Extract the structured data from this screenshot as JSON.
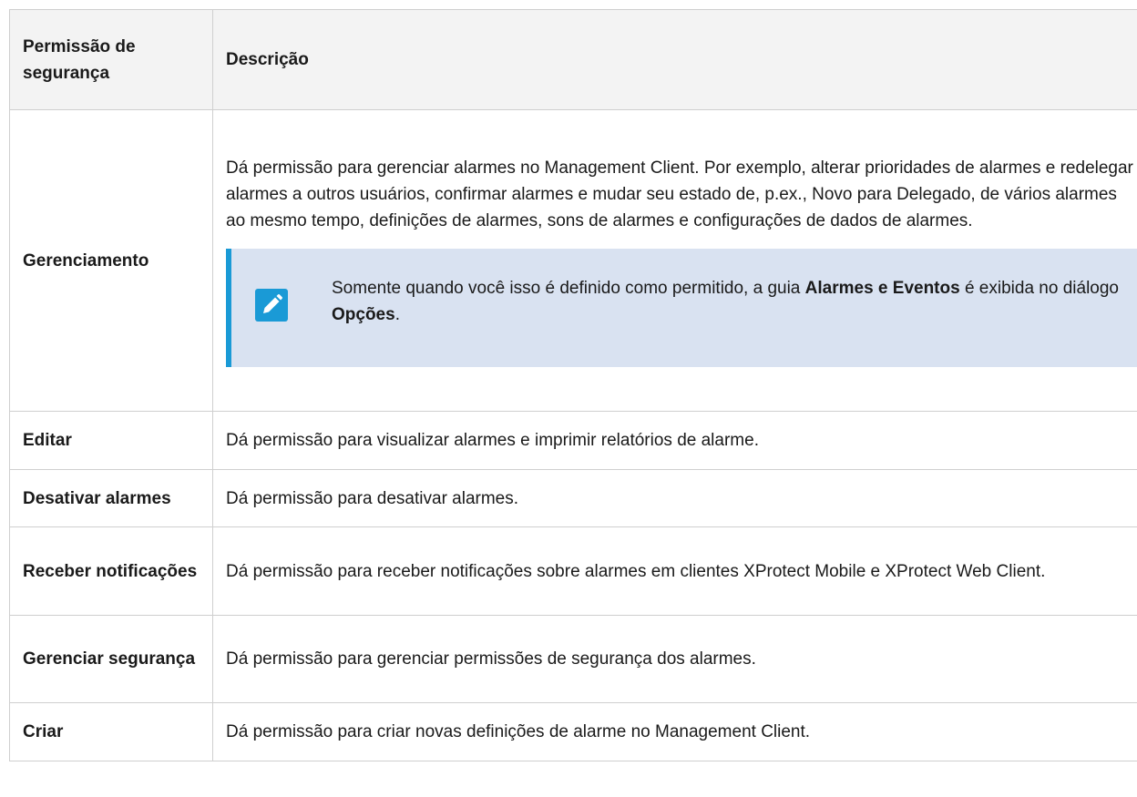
{
  "table": {
    "header": {
      "col1": "Permissão de segurança",
      "col2": "Descrição"
    },
    "rows": [
      {
        "permission": "Gerenciamento",
        "description": "Dá permissão para gerenciar alarmes no Management Client. Por exemplo, alterar prioridades de alarmes e redelegar alarmes a outros usuários, confirmar alarmes e mudar seu estado de, p.ex., Novo para Delegado, de vários alarmes ao mesmo tempo, definições de alarmes, sons de alarmes e configurações de dados de alarmes.",
        "note": {
          "icon": "pencil-icon",
          "text_before": "Somente quando você isso é definido como permitido, a guia ",
          "bold1": "Alarmes e Eventos",
          "text_middle": " é exibida no diálogo ",
          "bold2": "Opções",
          "text_after": "."
        }
      },
      {
        "permission": "Editar",
        "description": "Dá permissão para visualizar alarmes e imprimir relatórios de alarme."
      },
      {
        "permission": "Desativar alarmes",
        "description": "Dá permissão para desativar alarmes."
      },
      {
        "permission": "Receber notificações",
        "description": "Dá permissão para receber notificações sobre alarmes em clientes XProtect Mobile e XProtect Web Client."
      },
      {
        "permission": "Gerenciar segurança",
        "description": "Dá permissão para gerenciar permissões de segurança dos alarmes."
      },
      {
        "permission": "Criar",
        "description": "Dá permissão para criar novas definições de alarme no Management Client."
      }
    ]
  },
  "colors": {
    "header_bg": "#f3f3f3",
    "border": "#cfcfcf",
    "note_bg": "#d9e2f1",
    "note_accent": "#1a9ad6"
  }
}
